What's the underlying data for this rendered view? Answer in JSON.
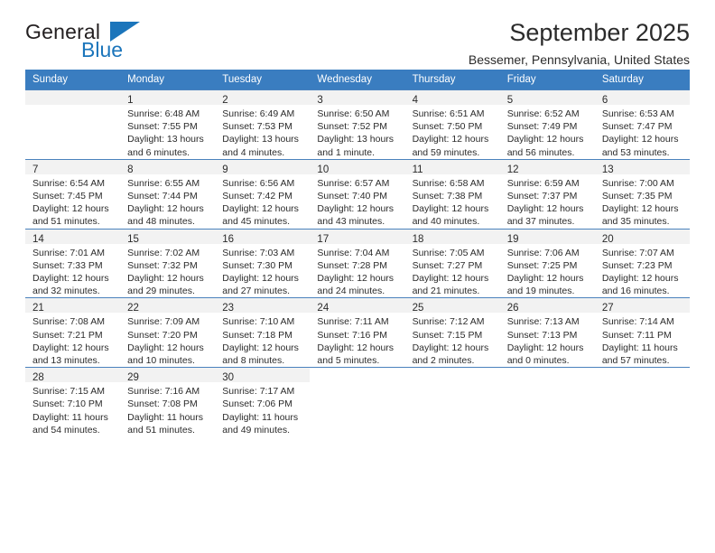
{
  "brand": {
    "word_one": "General",
    "word_two": "Blue",
    "flag_icon": "triangle-flag-icon",
    "accent_color": "#1b75bb"
  },
  "header": {
    "title": "September 2025",
    "subtitle": "Bessemer, Pennsylvania, United States"
  },
  "calendar": {
    "header_bg": "#3a7dc0",
    "daynum_bg": "#f2f2f2",
    "border_color": "#4a82bd",
    "weekday_headers": [
      "Sunday",
      "Monday",
      "Tuesday",
      "Wednesday",
      "Thursday",
      "Friday",
      "Saturday"
    ],
    "weeks": [
      [
        {
          "day": "",
          "lines": []
        },
        {
          "day": "1",
          "lines": [
            "Sunrise: 6:48 AM",
            "Sunset: 7:55 PM",
            "Daylight: 13 hours",
            "and 6 minutes."
          ]
        },
        {
          "day": "2",
          "lines": [
            "Sunrise: 6:49 AM",
            "Sunset: 7:53 PM",
            "Daylight: 13 hours",
            "and 4 minutes."
          ]
        },
        {
          "day": "3",
          "lines": [
            "Sunrise: 6:50 AM",
            "Sunset: 7:52 PM",
            "Daylight: 13 hours",
            "and 1 minute."
          ]
        },
        {
          "day": "4",
          "lines": [
            "Sunrise: 6:51 AM",
            "Sunset: 7:50 PM",
            "Daylight: 12 hours",
            "and 59 minutes."
          ]
        },
        {
          "day": "5",
          "lines": [
            "Sunrise: 6:52 AM",
            "Sunset: 7:49 PM",
            "Daylight: 12 hours",
            "and 56 minutes."
          ]
        },
        {
          "day": "6",
          "lines": [
            "Sunrise: 6:53 AM",
            "Sunset: 7:47 PM",
            "Daylight: 12 hours",
            "and 53 minutes."
          ]
        }
      ],
      [
        {
          "day": "7",
          "lines": [
            "Sunrise: 6:54 AM",
            "Sunset: 7:45 PM",
            "Daylight: 12 hours",
            "and 51 minutes."
          ]
        },
        {
          "day": "8",
          "lines": [
            "Sunrise: 6:55 AM",
            "Sunset: 7:44 PM",
            "Daylight: 12 hours",
            "and 48 minutes."
          ]
        },
        {
          "day": "9",
          "lines": [
            "Sunrise: 6:56 AM",
            "Sunset: 7:42 PM",
            "Daylight: 12 hours",
            "and 45 minutes."
          ]
        },
        {
          "day": "10",
          "lines": [
            "Sunrise: 6:57 AM",
            "Sunset: 7:40 PM",
            "Daylight: 12 hours",
            "and 43 minutes."
          ]
        },
        {
          "day": "11",
          "lines": [
            "Sunrise: 6:58 AM",
            "Sunset: 7:38 PM",
            "Daylight: 12 hours",
            "and 40 minutes."
          ]
        },
        {
          "day": "12",
          "lines": [
            "Sunrise: 6:59 AM",
            "Sunset: 7:37 PM",
            "Daylight: 12 hours",
            "and 37 minutes."
          ]
        },
        {
          "day": "13",
          "lines": [
            "Sunrise: 7:00 AM",
            "Sunset: 7:35 PM",
            "Daylight: 12 hours",
            "and 35 minutes."
          ]
        }
      ],
      [
        {
          "day": "14",
          "lines": [
            "Sunrise: 7:01 AM",
            "Sunset: 7:33 PM",
            "Daylight: 12 hours",
            "and 32 minutes."
          ]
        },
        {
          "day": "15",
          "lines": [
            "Sunrise: 7:02 AM",
            "Sunset: 7:32 PM",
            "Daylight: 12 hours",
            "and 29 minutes."
          ]
        },
        {
          "day": "16",
          "lines": [
            "Sunrise: 7:03 AM",
            "Sunset: 7:30 PM",
            "Daylight: 12 hours",
            "and 27 minutes."
          ]
        },
        {
          "day": "17",
          "lines": [
            "Sunrise: 7:04 AM",
            "Sunset: 7:28 PM",
            "Daylight: 12 hours",
            "and 24 minutes."
          ]
        },
        {
          "day": "18",
          "lines": [
            "Sunrise: 7:05 AM",
            "Sunset: 7:27 PM",
            "Daylight: 12 hours",
            "and 21 minutes."
          ]
        },
        {
          "day": "19",
          "lines": [
            "Sunrise: 7:06 AM",
            "Sunset: 7:25 PM",
            "Daylight: 12 hours",
            "and 19 minutes."
          ]
        },
        {
          "day": "20",
          "lines": [
            "Sunrise: 7:07 AM",
            "Sunset: 7:23 PM",
            "Daylight: 12 hours",
            "and 16 minutes."
          ]
        }
      ],
      [
        {
          "day": "21",
          "lines": [
            "Sunrise: 7:08 AM",
            "Sunset: 7:21 PM",
            "Daylight: 12 hours",
            "and 13 minutes."
          ]
        },
        {
          "day": "22",
          "lines": [
            "Sunrise: 7:09 AM",
            "Sunset: 7:20 PM",
            "Daylight: 12 hours",
            "and 10 minutes."
          ]
        },
        {
          "day": "23",
          "lines": [
            "Sunrise: 7:10 AM",
            "Sunset: 7:18 PM",
            "Daylight: 12 hours",
            "and 8 minutes."
          ]
        },
        {
          "day": "24",
          "lines": [
            "Sunrise: 7:11 AM",
            "Sunset: 7:16 PM",
            "Daylight: 12 hours",
            "and 5 minutes."
          ]
        },
        {
          "day": "25",
          "lines": [
            "Sunrise: 7:12 AM",
            "Sunset: 7:15 PM",
            "Daylight: 12 hours",
            "and 2 minutes."
          ]
        },
        {
          "day": "26",
          "lines": [
            "Sunrise: 7:13 AM",
            "Sunset: 7:13 PM",
            "Daylight: 12 hours",
            "and 0 minutes."
          ]
        },
        {
          "day": "27",
          "lines": [
            "Sunrise: 7:14 AM",
            "Sunset: 7:11 PM",
            "Daylight: 11 hours",
            "and 57 minutes."
          ]
        }
      ],
      [
        {
          "day": "28",
          "lines": [
            "Sunrise: 7:15 AM",
            "Sunset: 7:10 PM",
            "Daylight: 11 hours",
            "and 54 minutes."
          ]
        },
        {
          "day": "29",
          "lines": [
            "Sunrise: 7:16 AM",
            "Sunset: 7:08 PM",
            "Daylight: 11 hours",
            "and 51 minutes."
          ]
        },
        {
          "day": "30",
          "lines": [
            "Sunrise: 7:17 AM",
            "Sunset: 7:06 PM",
            "Daylight: 11 hours",
            "and 49 minutes."
          ]
        },
        {
          "day": "",
          "lines": []
        },
        {
          "day": "",
          "lines": []
        },
        {
          "day": "",
          "lines": []
        },
        {
          "day": "",
          "lines": []
        }
      ]
    ]
  }
}
